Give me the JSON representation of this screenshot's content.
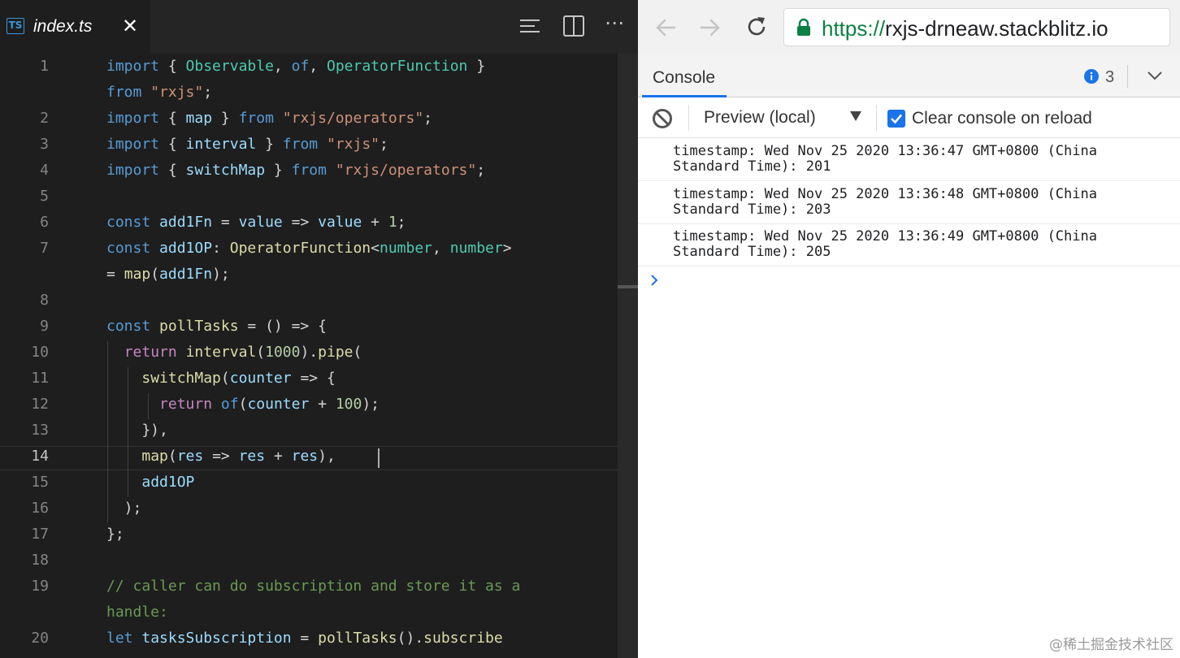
{
  "editor": {
    "tab": {
      "icon_label": "TS",
      "title": "index.ts",
      "close_glyph": "✕"
    },
    "toolbar": {
      "more_glyph": "⋯"
    },
    "lines": [
      {
        "num": "1",
        "tokens": [
          [
            "k",
            "import"
          ],
          [
            "p",
            " { "
          ],
          [
            "t",
            "Observable"
          ],
          [
            "p",
            ", "
          ],
          [
            "k",
            "of"
          ],
          [
            "p",
            ", "
          ],
          [
            "t",
            "OperatorFunction"
          ],
          [
            "p",
            " }"
          ]
        ]
      },
      {
        "num": "",
        "tokens": [
          [
            "k",
            "from"
          ],
          [
            "p",
            " "
          ],
          [
            "s",
            "\"rxjs\""
          ],
          [
            "p",
            ";"
          ]
        ]
      },
      {
        "num": "2",
        "tokens": [
          [
            "k",
            "import"
          ],
          [
            "p",
            " { "
          ],
          [
            "v",
            "map"
          ],
          [
            "p",
            " } "
          ],
          [
            "k",
            "from"
          ],
          [
            "p",
            " "
          ],
          [
            "s",
            "\"rxjs/operators\""
          ],
          [
            "p",
            ";"
          ]
        ]
      },
      {
        "num": "3",
        "tokens": [
          [
            "k",
            "import"
          ],
          [
            "p",
            " { "
          ],
          [
            "v",
            "interval"
          ],
          [
            "p",
            " } "
          ],
          [
            "k",
            "from"
          ],
          [
            "p",
            " "
          ],
          [
            "s",
            "\"rxjs\""
          ],
          [
            "p",
            ";"
          ]
        ]
      },
      {
        "num": "4",
        "tokens": [
          [
            "k",
            "import"
          ],
          [
            "p",
            " { "
          ],
          [
            "v",
            "switchMap"
          ],
          [
            "p",
            " } "
          ],
          [
            "k",
            "from"
          ],
          [
            "p",
            " "
          ],
          [
            "s",
            "\"rxjs/operators\""
          ],
          [
            "p",
            ";"
          ]
        ]
      },
      {
        "num": "5",
        "tokens": []
      },
      {
        "num": "6",
        "tokens": [
          [
            "k",
            "const"
          ],
          [
            "p",
            " "
          ],
          [
            "v",
            "add1Fn"
          ],
          [
            "p",
            " = "
          ],
          [
            "v",
            "value"
          ],
          [
            "p",
            " => "
          ],
          [
            "v",
            "value"
          ],
          [
            "p",
            " + "
          ],
          [
            "n",
            "1"
          ],
          [
            "p",
            ";"
          ]
        ]
      },
      {
        "num": "7",
        "tokens": [
          [
            "k",
            "const"
          ],
          [
            "p",
            " "
          ],
          [
            "v",
            "add1OP"
          ],
          [
            "p",
            ": "
          ],
          [
            "f",
            "OperatorFunction"
          ],
          [
            "p",
            "<"
          ],
          [
            "t",
            "number"
          ],
          [
            "p",
            ", "
          ],
          [
            "t",
            "number"
          ],
          [
            "p",
            ">"
          ]
        ]
      },
      {
        "num": "",
        "tokens": [
          [
            "p",
            "= "
          ],
          [
            "f",
            "map"
          ],
          [
            "p",
            "("
          ],
          [
            "v",
            "add1Fn"
          ],
          [
            "p",
            ");"
          ]
        ]
      },
      {
        "num": "8",
        "tokens": []
      },
      {
        "num": "9",
        "tokens": [
          [
            "k",
            "const"
          ],
          [
            "p",
            " "
          ],
          [
            "f",
            "pollTasks"
          ],
          [
            "p",
            " = () => {"
          ]
        ]
      },
      {
        "num": "10",
        "tokens": [
          [
            "p",
            "  "
          ],
          [
            "kc",
            "return"
          ],
          [
            "p",
            " "
          ],
          [
            "f",
            "interval"
          ],
          [
            "p",
            "("
          ],
          [
            "n",
            "1000"
          ],
          [
            "p",
            ")."
          ],
          [
            "f",
            "pipe"
          ],
          [
            "p",
            "("
          ]
        ]
      },
      {
        "num": "11",
        "tokens": [
          [
            "p",
            "    "
          ],
          [
            "f",
            "switchMap"
          ],
          [
            "p",
            "("
          ],
          [
            "v",
            "counter"
          ],
          [
            "p",
            " => {"
          ]
        ]
      },
      {
        "num": "12",
        "tokens": [
          [
            "p",
            "      "
          ],
          [
            "kc",
            "return"
          ],
          [
            "p",
            " "
          ],
          [
            "k",
            "of"
          ],
          [
            "p",
            "("
          ],
          [
            "v",
            "counter"
          ],
          [
            "p",
            " + "
          ],
          [
            "n",
            "100"
          ],
          [
            "p",
            ");"
          ]
        ]
      },
      {
        "num": "13",
        "tokens": [
          [
            "p",
            "    }),"
          ]
        ]
      },
      {
        "num": "14",
        "tokens": [
          [
            "p",
            "    "
          ],
          [
            "f",
            "map"
          ],
          [
            "p",
            "("
          ],
          [
            "v",
            "res"
          ],
          [
            "p",
            " => "
          ],
          [
            "v",
            "res"
          ],
          [
            "p",
            " + "
          ],
          [
            "v",
            "res"
          ],
          [
            "p",
            "),"
          ]
        ]
      },
      {
        "num": "15",
        "tokens": [
          [
            "p",
            "    "
          ],
          [
            "v",
            "add1OP"
          ]
        ]
      },
      {
        "num": "16",
        "tokens": [
          [
            "p",
            "  );"
          ]
        ]
      },
      {
        "num": "17",
        "tokens": [
          [
            "p",
            "};"
          ]
        ]
      },
      {
        "num": "18",
        "tokens": []
      },
      {
        "num": "19",
        "tokens": [
          [
            "c",
            "// caller can do subscription and store it as a"
          ]
        ]
      },
      {
        "num": "",
        "tokens": [
          [
            "c",
            "handle:"
          ]
        ]
      },
      {
        "num": "20",
        "tokens": [
          [
            "k",
            "let"
          ],
          [
            "p",
            " "
          ],
          [
            "v",
            "tasksSubscription"
          ],
          [
            "p",
            " = "
          ],
          [
            "f",
            "pollTasks"
          ],
          [
            "p",
            "()."
          ],
          [
            "f",
            "subscribe"
          ]
        ]
      }
    ],
    "current_line": "14"
  },
  "browser": {
    "url_scheme": "https://",
    "url_host": "rxjs-drneaw.stackblitz.io",
    "console": {
      "tab_label": "Console",
      "info_count": "3",
      "context_label": "Preview (local)",
      "clear_label": "Clear console on reload",
      "clear_checked": true,
      "logs": [
        "timestamp: Wed Nov 25 2020 13:36:47 GMT+0800 (China Standard Time): 201",
        "timestamp: Wed Nov 25 2020 13:36:48 GMT+0800 (China Standard Time): 203",
        "timestamp: Wed Nov 25 2020 13:36:49 GMT+0800 (China Standard Time): 205"
      ]
    }
  },
  "watermark": "@稀土掘金技术社区"
}
